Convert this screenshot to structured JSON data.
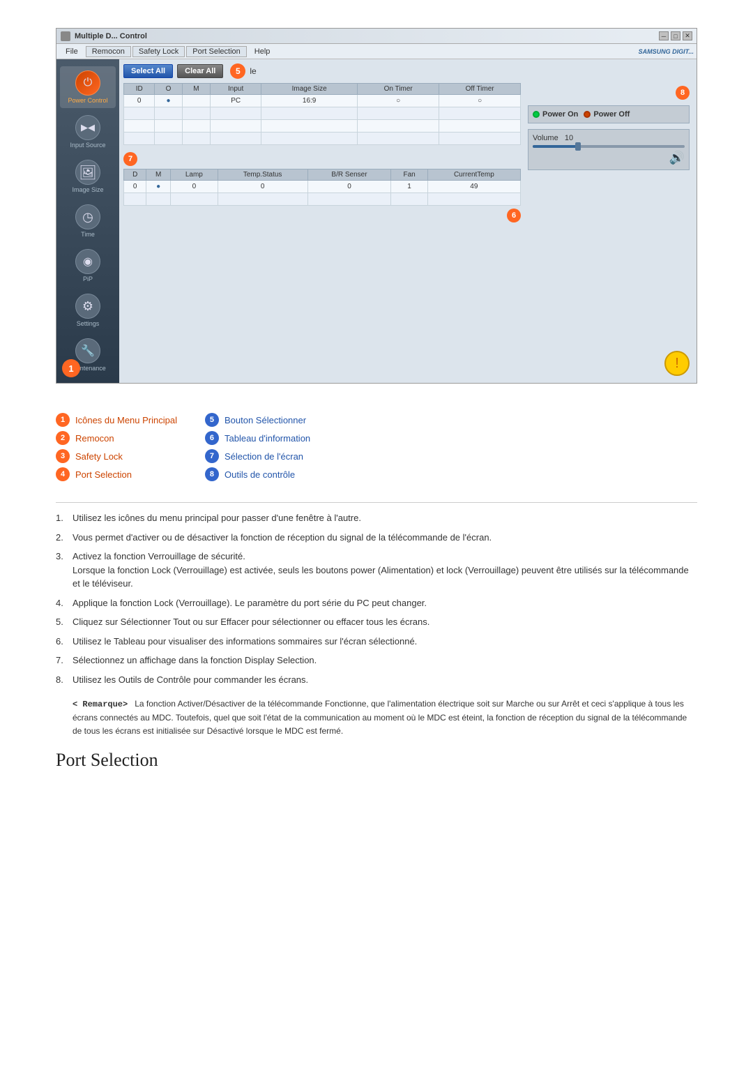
{
  "window": {
    "title": "Multiple Display Control",
    "title_short": "Multiple D... Control",
    "controls": {
      "minimize": "─",
      "maximize": "□",
      "close": "✕"
    },
    "samsung_logo": "SAMSUNG DIGIT..."
  },
  "menu": {
    "items": [
      "File",
      "Remocon",
      "Safety Lock",
      "Port Selection",
      "Help"
    ]
  },
  "toolbar": {
    "select_all": "Select All",
    "clear_all": "Clear All",
    "badge5": "5",
    "suffix": "le"
  },
  "table_top": {
    "headers": [
      "ID",
      "O",
      "M",
      "Input",
      "Image Size",
      "On Timer",
      "Off Timer"
    ],
    "rows": [
      [
        "0",
        "●",
        " ",
        "PC",
        "16:9",
        "○",
        "○"
      ]
    ]
  },
  "table_bottom": {
    "headers": [
      "D",
      "M",
      "Lamp",
      "Temp.Status",
      "B/R Senser",
      "Fan",
      "CurrentTemp"
    ],
    "rows": [
      [
        "0",
        "●",
        "0",
        "0",
        "0",
        "1",
        "49"
      ]
    ]
  },
  "power_control": {
    "power_on_label": "Power On",
    "power_off_label": "Power Off"
  },
  "volume": {
    "label": "Volume",
    "value": "10",
    "fill_percent": 30
  },
  "sidebar": {
    "items": [
      {
        "id": "power-control",
        "label": "Power Control",
        "icon": "⏻",
        "active": false
      },
      {
        "id": "input-source",
        "label": "Input Source",
        "icon": "▶",
        "active": false
      },
      {
        "id": "image-size",
        "label": "Image Size",
        "icon": "⊞",
        "active": false
      },
      {
        "id": "time",
        "label": "Time",
        "icon": "◷",
        "active": false
      },
      {
        "id": "pip",
        "label": "PiP",
        "icon": "◉",
        "active": false
      },
      {
        "id": "settings",
        "label": "Settings",
        "icon": "⚙",
        "active": false
      },
      {
        "id": "maintenance",
        "label": "Maintenance",
        "icon": "🔧",
        "active": false
      }
    ]
  },
  "badges": {
    "b1": "1",
    "b2": "2",
    "b3": "3",
    "b4": "4",
    "b5": "5",
    "b6": "6",
    "b7": "7",
    "b8": "8"
  },
  "legend": {
    "left": [
      {
        "num": "1",
        "text": "Icônes du Menu Principal",
        "color": "orange"
      },
      {
        "num": "2",
        "text": "Remocon",
        "color": "orange"
      },
      {
        "num": "3",
        "text": "Safety Lock",
        "color": "orange"
      },
      {
        "num": "4",
        "text": "Port Selection",
        "color": "orange"
      }
    ],
    "right": [
      {
        "num": "5",
        "text": "Bouton Sélectionner",
        "color": "blue"
      },
      {
        "num": "6",
        "text": "Tableau d'information",
        "color": "blue"
      },
      {
        "num": "7",
        "text": "Sélection de l'écran",
        "color": "blue"
      },
      {
        "num": "8",
        "text": "Outils de contrôle",
        "color": "blue"
      }
    ]
  },
  "instructions": [
    {
      "num": "1.",
      "text": "Utilisez les icônes du menu principal pour passer d'une fenêtre à l'autre."
    },
    {
      "num": "2.",
      "text": "Vous permet d'activer ou de désactiver la fonction de réception du signal de la télécommande de l'écran."
    },
    {
      "num": "3.",
      "text": "Activez la fonction Verrouillage de sécurité.\nLorsque la fonction Lock (Verrouillage) est activée, seuls les boutons power (Alimentation) et lock (Verrouillage) peuvent être utilisés sur la télécommande et le téléviseur."
    },
    {
      "num": "4.",
      "text": "Applique la fonction Lock (Verrouillage). Le paramètre du port série du PC peut changer."
    },
    {
      "num": "5.",
      "text": "Cliquez sur Sélectionner Tout ou sur Effacer pour sélectionner ou effacer tous les écrans."
    },
    {
      "num": "6.",
      "text": "Utilisez le Tableau pour visualiser des informations sommaires sur l'écran sélectionné."
    },
    {
      "num": "7.",
      "text": "Sélectionnez un affichage dans la fonction Display Selection."
    },
    {
      "num": "8.",
      "text": "Utilisez les Outils de Contrôle pour commander les écrans."
    }
  ],
  "remark": {
    "label": "< Remarque>",
    "text": "La fonction Activer/Désactiver de la télécommande Fonctionne, que l'alimentation électrique soit sur Marche ou sur Arrêt et ceci s'applique à tous les écrans connectés au MDC. Toutefois, quel que soit l'état de la communication au moment où le MDC est éteint, la fonction de réception du signal de la télécommande de tous les écrans est initialisée sur Désactivé lorsque le MDC est fermé."
  },
  "page_heading": "Port Selection"
}
